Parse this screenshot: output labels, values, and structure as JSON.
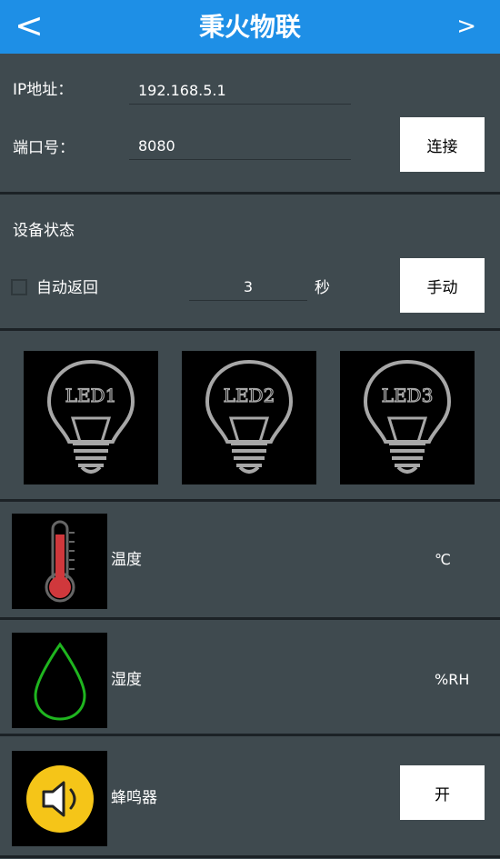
{
  "header": {
    "back": "<",
    "title": "秉火物联",
    "next": ">"
  },
  "connection": {
    "ip_label": "IP地址：",
    "ip_value": "192.168.5.1",
    "port_label": "端口号：",
    "port_value": "8080",
    "connect_button": "连接"
  },
  "device_status": {
    "title": "设备状态",
    "auto_return_label": "自动返回",
    "auto_return_checked": false,
    "seconds_value": "3",
    "seconds_unit": "秒",
    "manual_button": "手动"
  },
  "leds": [
    {
      "label": "LED1"
    },
    {
      "label": "LED2"
    },
    {
      "label": "LED3"
    }
  ],
  "sensors": {
    "temperature": {
      "label": "温度",
      "unit": "℃"
    },
    "humidity": {
      "label": "湿度",
      "unit": "%RH"
    },
    "buzzer": {
      "label": "蜂鸣器",
      "button": "开"
    }
  },
  "colors": {
    "header": "#1e8fe6",
    "background": "#3f4a4f",
    "thermometer": "#d0383c",
    "droplet": "#1fb51f",
    "speaker": "#f5c518"
  }
}
